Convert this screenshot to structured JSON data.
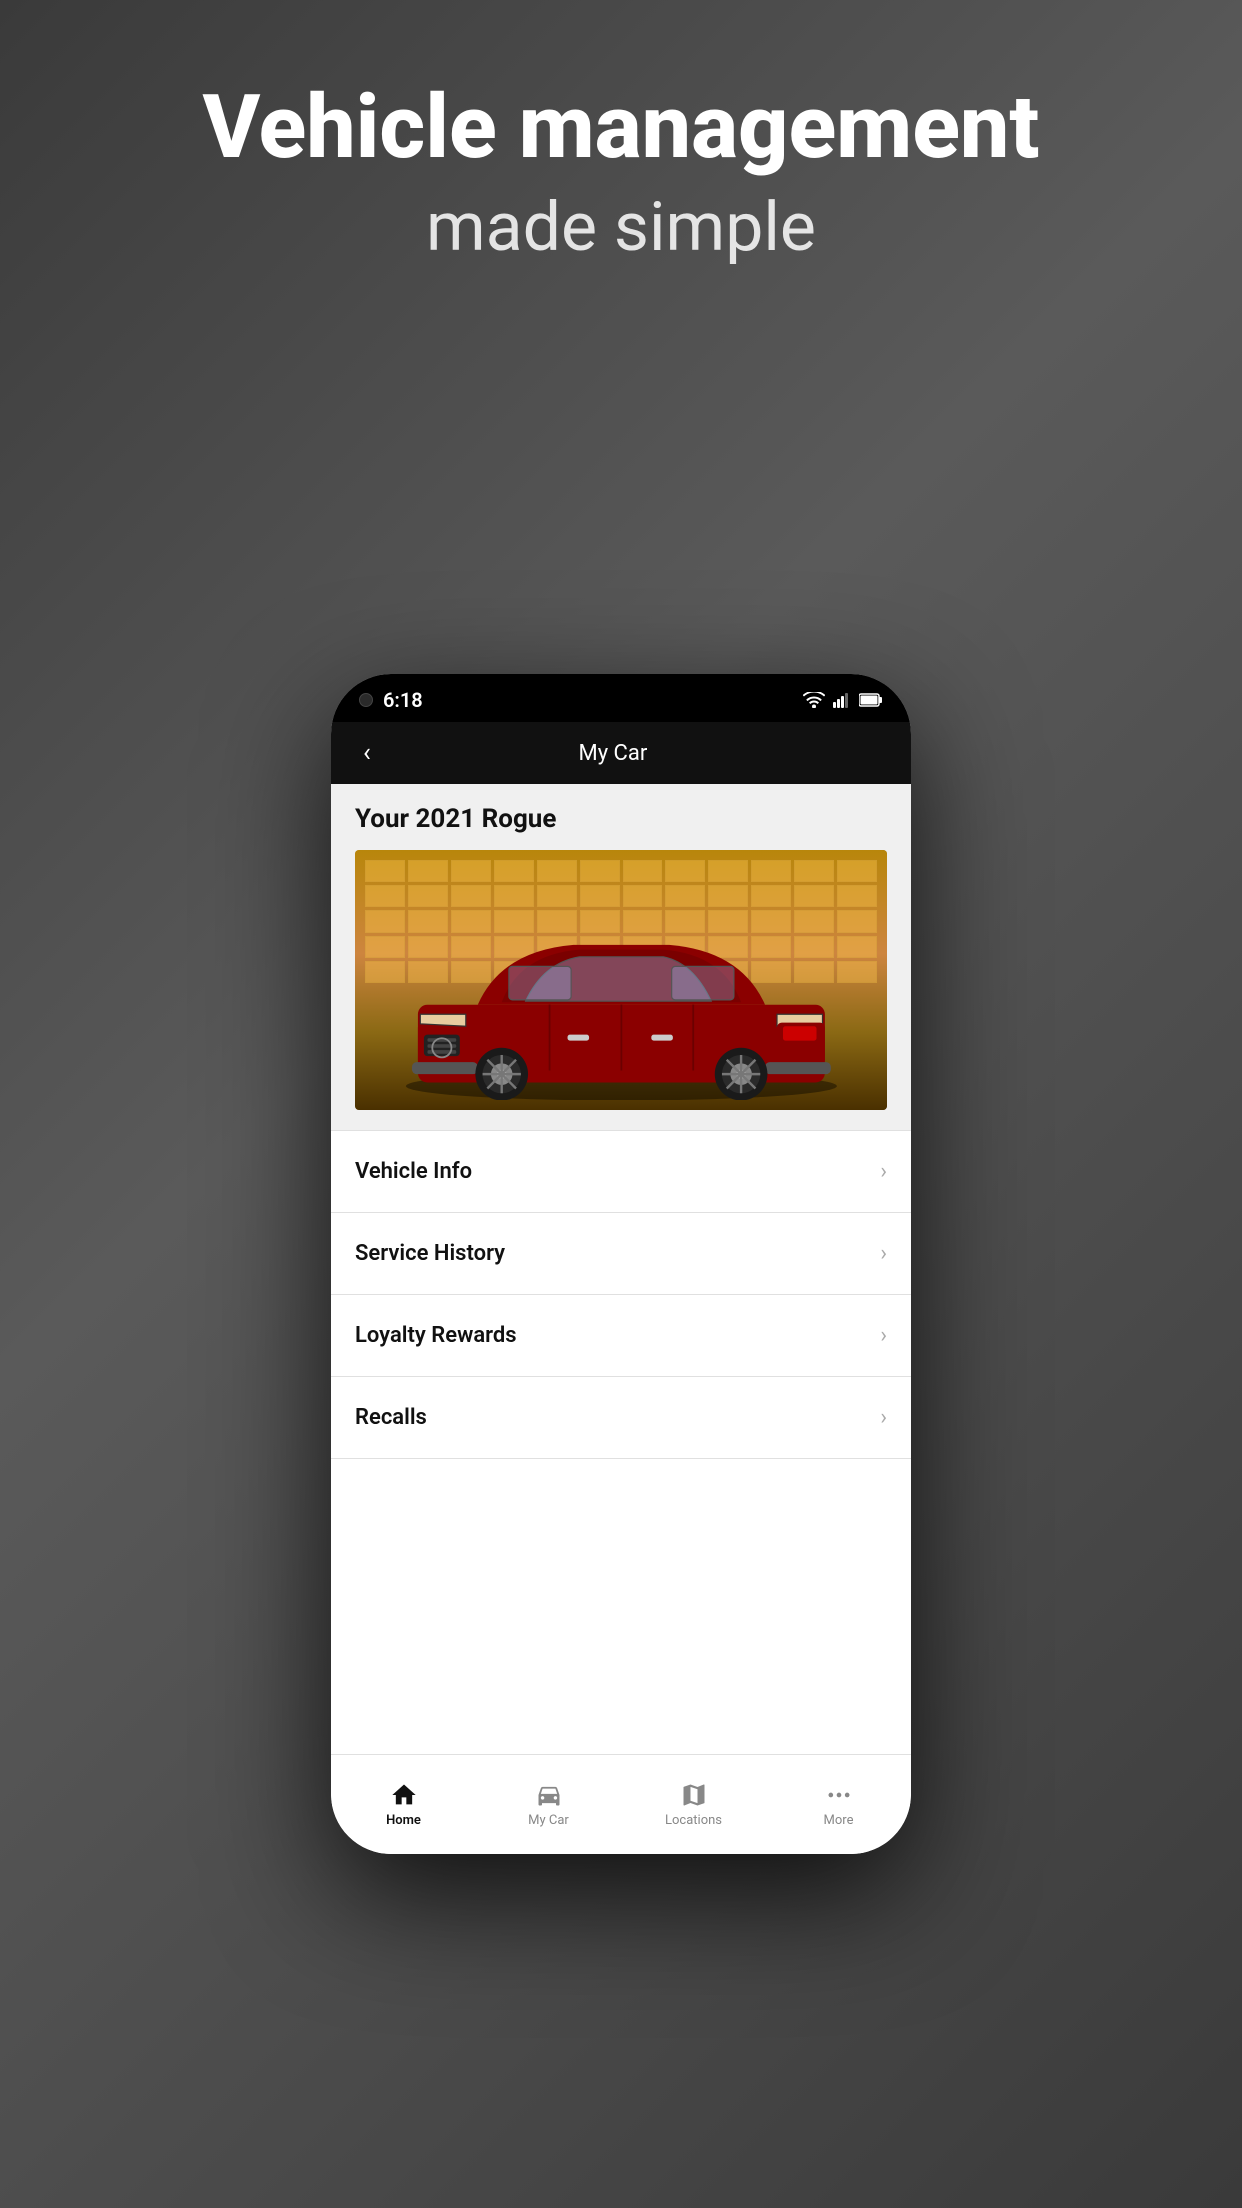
{
  "background": {
    "title": "Vehicle management",
    "subtitle": "made simple"
  },
  "status_bar": {
    "time": "6:18",
    "wifi": "▼",
    "signal": "◀",
    "battery": "🔋"
  },
  "nav": {
    "back_label": "‹",
    "title": "My Car"
  },
  "car_card": {
    "title": "Your 2021 Rogue"
  },
  "menu_items": [
    {
      "id": "vehicle-info",
      "label": "Vehicle Info"
    },
    {
      "id": "service-history",
      "label": "Service History"
    },
    {
      "id": "loyalty-rewards",
      "label": "Loyalty Rewards"
    },
    {
      "id": "recalls",
      "label": "Recalls"
    }
  ],
  "tab_bar": {
    "items": [
      {
        "id": "home",
        "icon": "🏠",
        "label": "Home",
        "active": true
      },
      {
        "id": "my-car",
        "icon": "🚗",
        "label": "My Car",
        "active": false
      },
      {
        "id": "locations",
        "icon": "🗺",
        "label": "Locations",
        "active": false
      },
      {
        "id": "more",
        "icon": "···",
        "label": "More",
        "active": false
      }
    ]
  }
}
